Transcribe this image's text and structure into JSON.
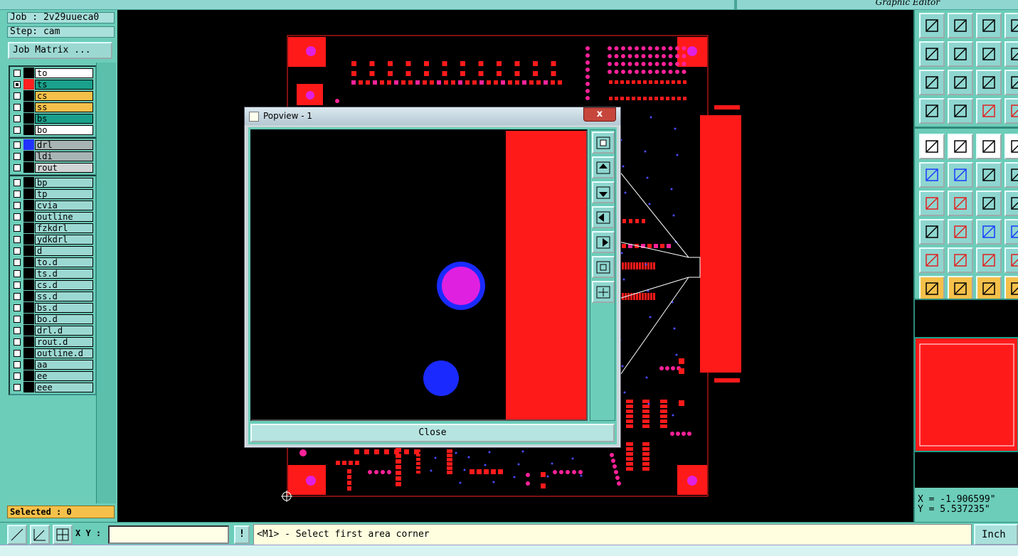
{
  "window": {
    "title": "Graphic Editor"
  },
  "job": {
    "job_text": "Job : 2v29uueca0",
    "step_text": "Step: cam",
    "matrix_button": "Job Matrix ..."
  },
  "layers": {
    "group1": [
      {
        "name": "to",
        "color": "#ffffff",
        "swatch": "#000000",
        "checked": false
      },
      {
        "name": "ts",
        "color": "#1aa08b",
        "swatch": "#ff2020",
        "checked": true
      },
      {
        "name": "cs",
        "color": "#f5c04a",
        "swatch": "#000000",
        "checked": false
      },
      {
        "name": "ss",
        "color": "#f5c04a",
        "swatch": "#000000",
        "checked": false
      },
      {
        "name": "bs",
        "color": "#1aa08b",
        "swatch": "#000000",
        "checked": false
      },
      {
        "name": "bo",
        "color": "#ffffff",
        "swatch": "#000000",
        "checked": false
      }
    ],
    "group2": [
      {
        "name": "drl",
        "color": "#a8b4b4",
        "swatch": "#2233ff",
        "checked": false
      },
      {
        "name": "ldi",
        "color": "#a8b4b4",
        "swatch": "#000000",
        "checked": false
      },
      {
        "name": "rout",
        "color": "#d0d4d4",
        "swatch": "#000000",
        "checked": false
      }
    ],
    "group3": [
      "bp",
      "tp",
      "cvia",
      "outline",
      "fzkdrl",
      "ydkdrl",
      "d",
      "to.d",
      "ts.d",
      "cs.d",
      "ss.d",
      "bs.d",
      "bo.d",
      "drl.d",
      "rout.d",
      "outline.d",
      "aa",
      "ee",
      "eee"
    ]
  },
  "selected": "Selected : 0",
  "bottom": {
    "xy_label": "X Y :",
    "xy_value": "",
    "bang": "!",
    "message": "<M1> - Select first area corner",
    "unit": "Inch"
  },
  "coords": {
    "x": "X = -1.906599\"",
    "y": "Y = 5.537235\""
  },
  "popview": {
    "title": "Popview - 1",
    "close_x": "x",
    "close_button": "Close"
  },
  "colors": {
    "panel": "#6ccdb9",
    "pad_red": "#ff1a1a",
    "pad_pink": "#ff2299",
    "via_magenta": "#e020e0",
    "drill_blue": "#1a2aff"
  }
}
